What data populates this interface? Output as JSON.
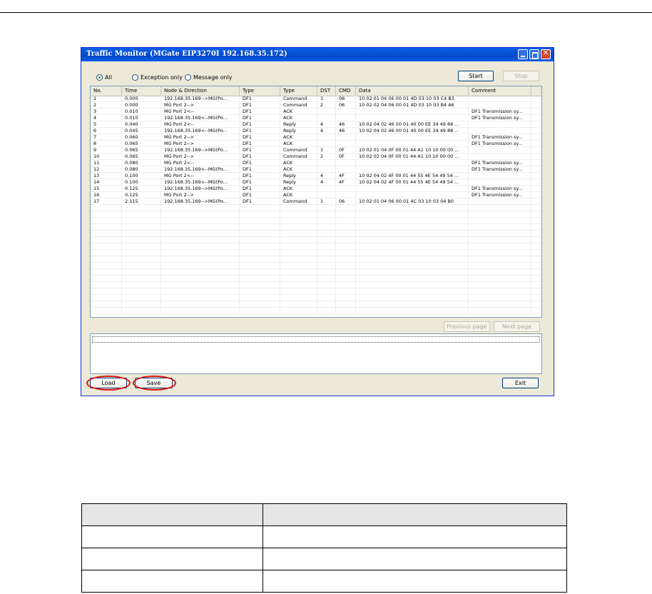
{
  "window": {
    "title": "Traffic Monitor (MGate EIP3270I 192.168.35.172)",
    "radios": [
      {
        "label": "All",
        "selected": true
      },
      {
        "label": "Exception only",
        "selected": false
      },
      {
        "label": "Message only",
        "selected": false
      }
    ],
    "start_label": "Start",
    "stop_label": "Stop",
    "columns": [
      "No.",
      "Time",
      "Node & Direction",
      "Type",
      "Type",
      "DST",
      "CMD",
      "Data",
      "Comment"
    ],
    "rows": [
      [
        "1",
        "0.000",
        "192.168.35.169-->MG(Po...",
        "DF1",
        "Command",
        "1",
        "06",
        "10 02 01 04 06 00 01 4D 03 10 03 C4 B3",
        ""
      ],
      [
        "2",
        "0.000",
        "MG Port 2-->",
        "DF1",
        "Command",
        "2",
        "06",
        "10 02 02 04 06 00 01 4D 03 10 03 B4 A6",
        ""
      ],
      [
        "3",
        "0.010",
        "MG Port 2<--",
        "DF1",
        "ACK",
        "",
        "",
        "",
        "DF1 Transmission sy..."
      ],
      [
        "4",
        "0.010",
        "192.168.35.169<--MG(Po...",
        "DF1",
        "ACK",
        "",
        "",
        "",
        "DF1 Transmission sy..."
      ],
      [
        "5",
        "0.040",
        "MG Port 2<--",
        "DF1",
        "Reply",
        "4",
        "46",
        "10 02 04 02 46 00 01 40 00 EE 34 49 88 ...",
        ""
      ],
      [
        "6",
        "0.045",
        "192.168.35.169<--MG(Po...",
        "DF1",
        "Reply",
        "4",
        "46",
        "10 02 04 02 46 00 01 40 00 EE 34 49 88 ...",
        ""
      ],
      [
        "7",
        "0.060",
        "MG Port 2-->",
        "DF1",
        "ACK",
        "",
        "",
        "",
        "DF1 Transmission sy..."
      ],
      [
        "8",
        "0.065",
        "MG Port 2-->",
        "DF1",
        "ACK",
        "",
        "",
        "",
        "DF1 Transmission sy..."
      ],
      [
        "9",
        "0.065",
        "192.168.35.169-->MG(Po...",
        "DF1",
        "Command",
        "1",
        "0F",
        "10 02 01 04 0F 00 01 44 A1 10 10 00 00 ...",
        ""
      ],
      [
        "10",
        "0.065",
        "MG Port 2-->",
        "DF1",
        "Command",
        "2",
        "0F",
        "10 02 02 04 0F 00 01 44 A1 10 10 00 00 ...",
        ""
      ],
      [
        "11",
        "0.080",
        "MG Port 2<--",
        "DF1",
        "ACK",
        "",
        "",
        "",
        "DF1 Transmission sy..."
      ],
      [
        "12",
        "0.080",
        "192.168.35.169<--MG(Po...",
        "DF1",
        "ACK",
        "",
        "",
        "",
        "DF1 Transmission sy..."
      ],
      [
        "13",
        "0.100",
        "MG Port 2<--",
        "DF1",
        "Reply",
        "4",
        "4F",
        "10 02 04 02 4F 00 01 44 55 4E 54 49 54 ...",
        ""
      ],
      [
        "14",
        "0.100",
        "192.168.35.169<--MG(Po...",
        "DF1",
        "Reply",
        "4",
        "4F",
        "10 02 04 02 4F 00 01 44 55 4E 54 49 54 ...",
        ""
      ],
      [
        "15",
        "0.125",
        "192.168.35.169-->MG(Po...",
        "DF1",
        "ACK",
        "",
        "",
        "",
        "DF1 Transmission sy..."
      ],
      [
        "16",
        "0.125",
        "MG Port 2-->",
        "DF1",
        "ACK",
        "",
        "",
        "",
        "DF1 Transmission sy..."
      ],
      [
        "17",
        "2.115",
        "192.168.35.169-->MG(Po...",
        "DF1",
        "Command",
        "1",
        "06",
        "10 02 01 04 06 00 01 4C 03 10 03 04 B0",
        ""
      ]
    ],
    "previous_page_label": "Previous page",
    "next_page_label": "Next page",
    "load_label": "Load",
    "save_label": "Save",
    "exit_label": "Exit"
  },
  "colors": {
    "highlight_oval": "#e01010",
    "titlebar": "#0a5ee8"
  }
}
